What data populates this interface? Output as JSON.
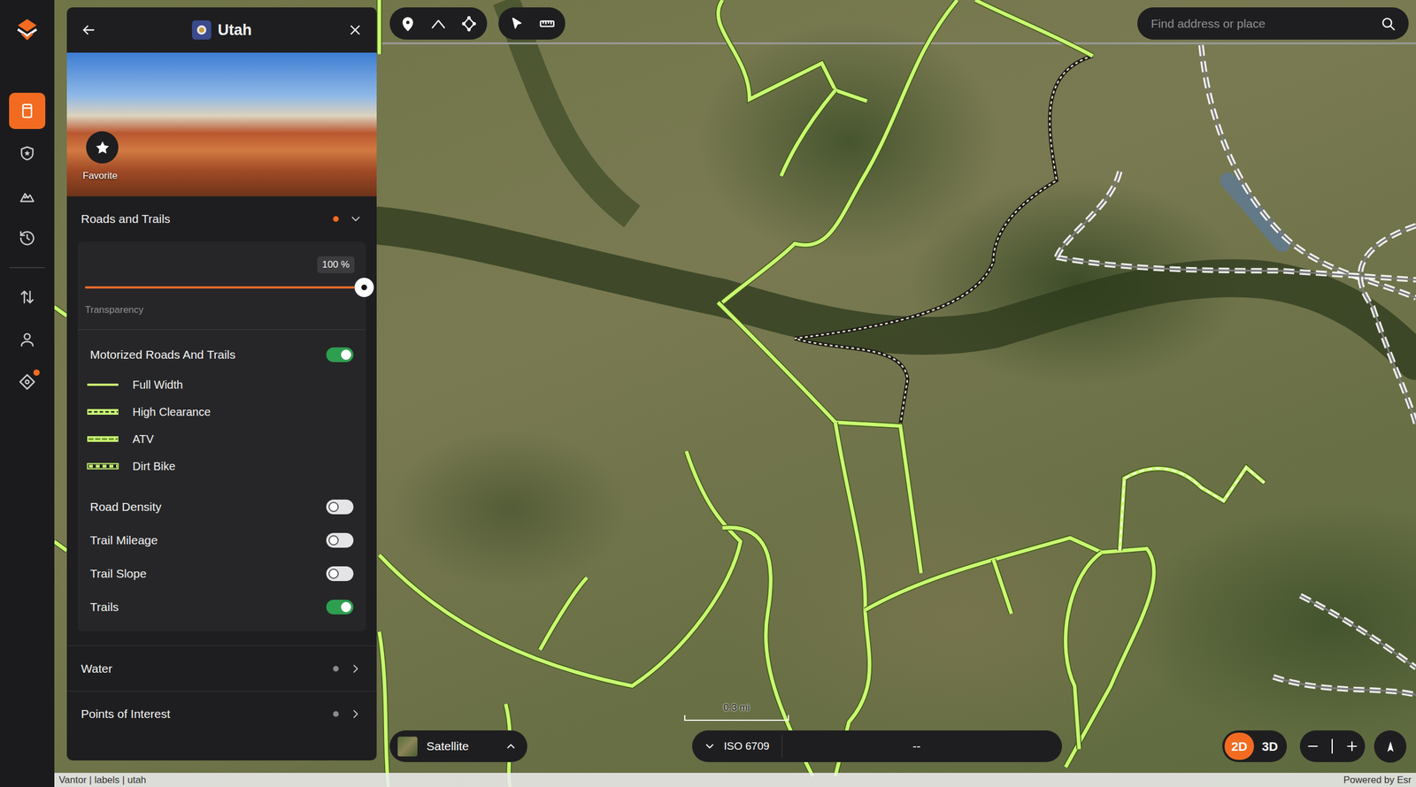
{
  "sidebar": {
    "items": [
      {
        "selected": true,
        "notification": false
      },
      {
        "selected": false,
        "notification": false
      },
      {
        "selected": false,
        "notification": false
      },
      {
        "selected": false,
        "notification": false
      },
      {
        "selected": false,
        "notification": false
      },
      {
        "selected": false,
        "notification": false
      },
      {
        "selected": false,
        "notification": true
      }
    ]
  },
  "panel": {
    "title": "Utah",
    "favorite": {
      "label": "Favorite"
    }
  },
  "sections": [
    {
      "title": "Roads and Trails",
      "expanded": true,
      "color": "#f26b21"
    },
    {
      "title": "Water",
      "expanded": false,
      "color": "#8a8a8e"
    },
    {
      "title": "Points of Interest",
      "expanded": false,
      "color": "#8a8a8e"
    }
  ],
  "roads_and_trails": {
    "transparency": {
      "label": "Transparency",
      "reading": "100 %",
      "level": 1
    },
    "layers": [
      {
        "label": "Motorized Roads And Trails",
        "on": true,
        "legend": [
          {
            "label": "Full Width",
            "kind": "full-width"
          },
          {
            "label": "High Clearance",
            "kind": "high-clearance"
          },
          {
            "label": "ATV",
            "kind": "atv"
          },
          {
            "label": "Dirt Bike",
            "kind": "dirt-bike"
          }
        ]
      },
      {
        "label": "Road Density",
        "on": false,
        "legend": []
      },
      {
        "label": "Trail Mileage",
        "on": false,
        "legend": []
      },
      {
        "label": "Trail Slope",
        "on": false,
        "legend": []
      },
      {
        "label": "Trails",
        "on": true,
        "legend": []
      }
    ]
  },
  "search": {
    "placeholder": "Find address or place"
  },
  "basemap": {
    "label": "Satellite"
  },
  "coordinates": {
    "format": "ISO 6709",
    "value": "--"
  },
  "view_modes": [
    {
      "label": "2D",
      "selected": true
    },
    {
      "label": "3D",
      "selected": false
    }
  ],
  "scale": {
    "label": "0.3 mi"
  },
  "attribution": {
    "left": "Vantor | labels | utah",
    "right": "Powered by Esr"
  }
}
